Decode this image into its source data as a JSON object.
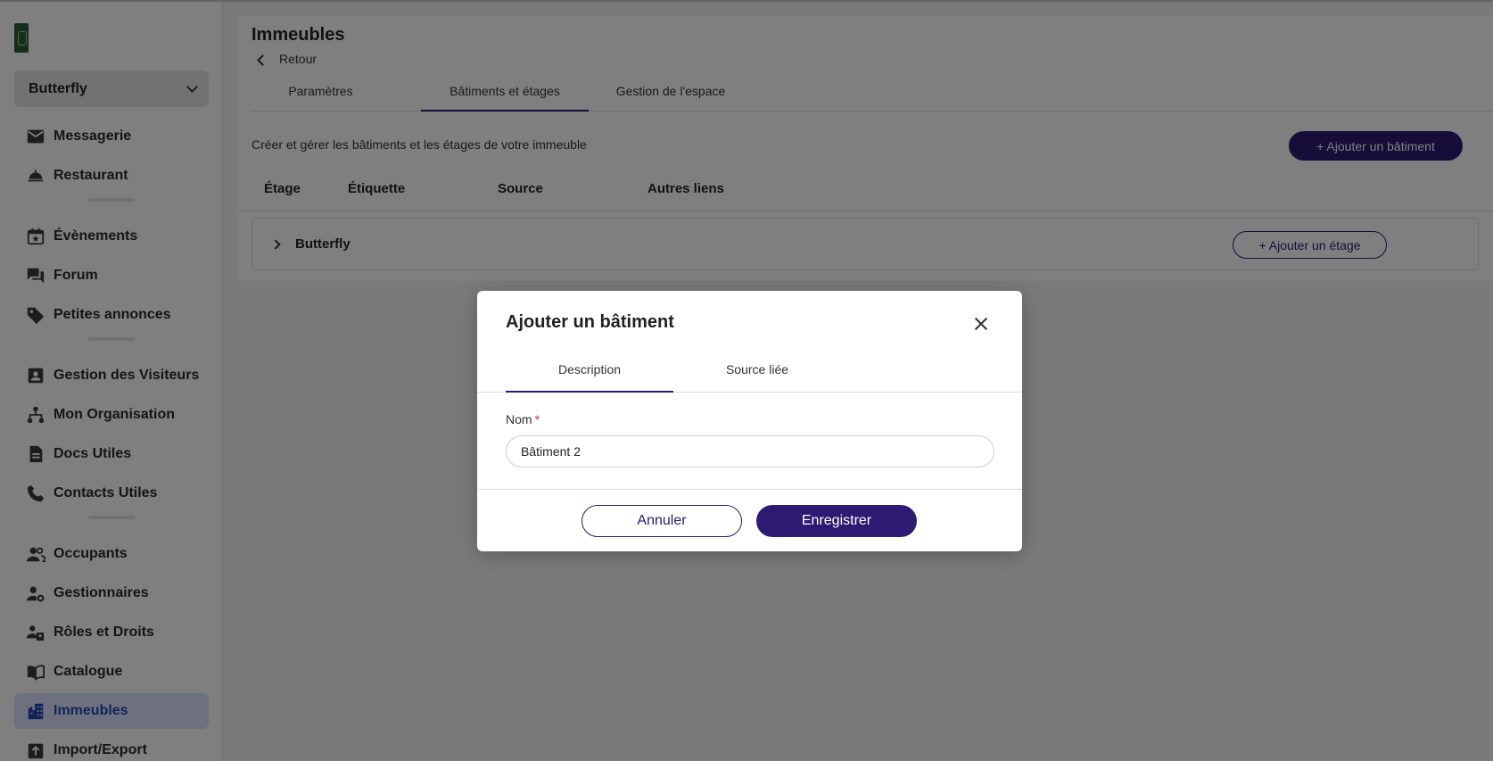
{
  "sidebar": {
    "org_selector": "Butterfly",
    "groups": [
      [
        {
          "label": "Messagerie",
          "icon": "mail-icon"
        },
        {
          "label": "Restaurant",
          "icon": "cloche-icon"
        }
      ],
      [
        {
          "label": "Évènements",
          "icon": "calendar-star-icon"
        },
        {
          "label": "Forum",
          "icon": "forum-icon"
        },
        {
          "label": "Petites annonces",
          "icon": "tag-icon"
        }
      ],
      [
        {
          "label": "Gestion des Visiteurs",
          "icon": "badge-icon"
        },
        {
          "label": "Mon Organisation",
          "icon": "org-chart-icon"
        },
        {
          "label": "Docs Utiles",
          "icon": "document-icon"
        },
        {
          "label": "Contacts Utiles",
          "icon": "phone-icon"
        }
      ],
      [
        {
          "label": "Occupants",
          "icon": "people-icon"
        },
        {
          "label": "Gestionnaires",
          "icon": "user-gear-icon"
        },
        {
          "label": "Rôles et Droits",
          "icon": "roles-icon"
        },
        {
          "label": "Catalogue",
          "icon": "book-icon"
        },
        {
          "label": "Immeubles",
          "icon": "building-icon",
          "active": true
        },
        {
          "label": "Import/Export",
          "icon": "import-export-icon"
        }
      ]
    ]
  },
  "page": {
    "title": "Immeubles",
    "back": "Retour",
    "tabs": [
      "Paramètres",
      "Bâtiments et étages",
      "Gestion de l'espace"
    ],
    "active_tab": 1,
    "description": "Créer et gérer les bâtiments et les étages de votre immeuble",
    "add_building": "+ Ajouter un bâtiment",
    "columns": [
      "Étage",
      "Étiquette",
      "Source",
      "Autres liens"
    ],
    "buildings": [
      {
        "name": "Butterfly",
        "add_floor": "+ Ajouter un étage"
      }
    ]
  },
  "modal": {
    "title": "Ajouter un bâtiment",
    "tabs": [
      "Description",
      "Source liée"
    ],
    "active_tab": 0,
    "field_label": "Nom",
    "required_mark": "*",
    "field_value": "Bâtiment 2",
    "cancel": "Annuler",
    "save": "Enregistrer"
  },
  "colors": {
    "primary": "#2e1a73",
    "active_nav_bg": "#dbe3ff",
    "active_nav_text": "#2747b5",
    "required": "#d32f2f"
  }
}
